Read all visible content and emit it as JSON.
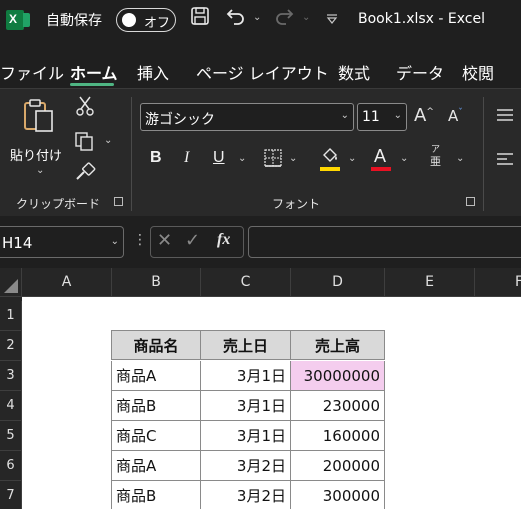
{
  "titlebar": {
    "app_icon_letter": "X",
    "autosave_label": "自動保存",
    "autosave_state": "オフ",
    "doc_title": "Book1.xlsx  -  Excel"
  },
  "tabs": [
    {
      "label": "ファイル",
      "active": false
    },
    {
      "label": "ホーム",
      "active": true
    },
    {
      "label": "挿入",
      "active": false
    },
    {
      "label": "ページ レイアウト",
      "active": false
    },
    {
      "label": "数式",
      "active": false
    },
    {
      "label": "データ",
      "active": false
    },
    {
      "label": "校閲",
      "active": false
    }
  ],
  "ribbon": {
    "clipboard": {
      "paste_label": "貼り付け",
      "group_label": "クリップボード"
    },
    "font": {
      "font_name": "游ゴシック",
      "font_size": "11",
      "group_label": "フォント",
      "bold": "B",
      "italic": "I",
      "underline": "U",
      "font_color_letter": "A",
      "fill_color": "#ffd700",
      "font_color": "#e81123",
      "phonetic_top": "ア",
      "phonetic_bottom": "亜"
    }
  },
  "formula_bar": {
    "name_box": "H14",
    "fx_label": "fx",
    "formula": ""
  },
  "grid": {
    "columns": [
      "A",
      "B",
      "C",
      "D",
      "E",
      "F"
    ],
    "rows": [
      "1",
      "2",
      "3",
      "4",
      "5",
      "6",
      "7"
    ],
    "table": {
      "headers": [
        "商品名",
        "売上日",
        "売上高"
      ],
      "rows": [
        [
          "商品A",
          "3月1日",
          "30000000"
        ],
        [
          "商品B",
          "3月1日",
          "230000"
        ],
        [
          "商品C",
          "3月1日",
          "160000"
        ],
        [
          "商品A",
          "3月2日",
          "200000"
        ],
        [
          "商品B",
          "3月2日",
          "300000"
        ]
      ]
    },
    "highlight_color": "#f4cdee"
  }
}
